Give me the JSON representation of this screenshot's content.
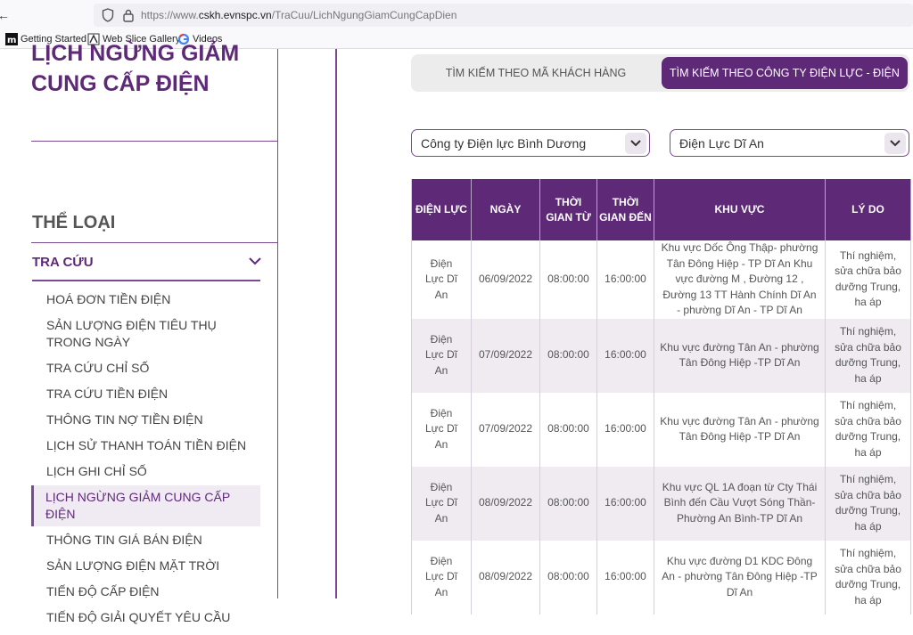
{
  "browser": {
    "url_prefix": "https://www.",
    "url_domain": "cskh.evnspc.vn",
    "url_path": "/TraCuu/LichNgungGiamCungCapDien",
    "bookmarks": [
      "Getting Started",
      "Web Slice Gallery",
      "Videos"
    ]
  },
  "sidebar": {
    "page_title": "LỊCH NGỪNG GIẢM CUNG CẤP ĐIỆN",
    "category_title": "THỂ LOẠI",
    "section_label": "TRA CỨU",
    "items": [
      "HOÁ ĐƠN TIỀN ĐIỆN",
      "SẢN LƯỢNG ĐIỆN TIÊU THỤ TRONG NGÀY",
      "TRA CỨU CHỈ SỐ",
      "TRA CỨU TIỀN ĐIỆN",
      "THÔNG TIN NỢ TIỀN ĐIỆN",
      "LỊCH SỬ THANH TOÁN TIỀN ĐIỆN",
      "LỊCH GHI CHỈ SỐ",
      "LỊCH NGỪNG GIẢM CUNG CẤP ĐIỆN",
      "THÔNG TIN GIÁ BÁN ĐIỆN",
      "SẢN LƯỢNG ĐIỆN MẶT TRỜI",
      "TIẾN ĐỘ CẤP ĐIỆN",
      "TIẾN ĐỘ GIẢI QUYẾT YÊU CẦU"
    ],
    "active_index": 7
  },
  "tabs": {
    "by_customer": "TÌM KIẾM THEO MÃ KHÁCH HÀNG",
    "by_company": "TÌM KIẾM THEO CÔNG TY ĐIỆN LỰC - ĐIỆN LỰC"
  },
  "filters": {
    "company": "Công ty Điện lực Bình Dương",
    "branch": "Điện Lực Dĩ An"
  },
  "table": {
    "headers": [
      "ĐIỆN LỰC",
      "NGÀY",
      "THỜI GIAN TỪ",
      "THỜI GIAN ĐẾN",
      "KHU VỰC",
      "LÝ DO"
    ],
    "rows": [
      [
        "Điện Lực Dĩ An",
        "06/09/2022",
        "08:00:00",
        "16:00:00",
        "Khu vực Dốc Ông Thập- phường Tân Đông Hiệp - TP Dĩ An Khu vực đường M , Đường 12 , Đường 13 TT Hành Chính Dĩ An - phường Dĩ An - TP Dĩ An",
        "Thí nghiệm, sửa chữa bảo dưỡng Trung, ha áp"
      ],
      [
        "Điện Lực Dĩ An",
        "07/09/2022",
        "08:00:00",
        "16:00:00",
        "Khu vực đường Tân An - phường Tân Đông Hiệp -TP Dĩ An",
        "Thí nghiệm, sửa chữa bảo dưỡng Trung, ha áp"
      ],
      [
        "Điện Lực Dĩ An",
        "07/09/2022",
        "08:00:00",
        "16:00:00",
        "Khu vực đường Tân An - phường Tân Đông Hiệp -TP Dĩ An",
        "Thí nghiệm, sửa chữa bảo dưỡng Trung, ha áp"
      ],
      [
        "Điện Lực Dĩ An",
        "08/09/2022",
        "08:00:00",
        "16:00:00",
        "Khu vực QL 1A đoạn từ Cty Thái Bình đến Cầu Vượt Sóng Thần- Phường An Bình-TP Dĩ An",
        "Thí nghiệm, sửa chữa bảo dưỡng Trung, ha áp"
      ],
      [
        "Điện Lực Dĩ An",
        "08/09/2022",
        "08:00:00",
        "16:00:00",
        "Khu vực đường D1 KDC Đông An - phường Tân Đông Hiệp -TP Dĩ An",
        "Thí nghiệm, sửa chữa bảo dưỡng Trung, ha áp"
      ]
    ]
  },
  "colors": {
    "accent": "#5e2a78",
    "row_alt": "#efebf1"
  }
}
